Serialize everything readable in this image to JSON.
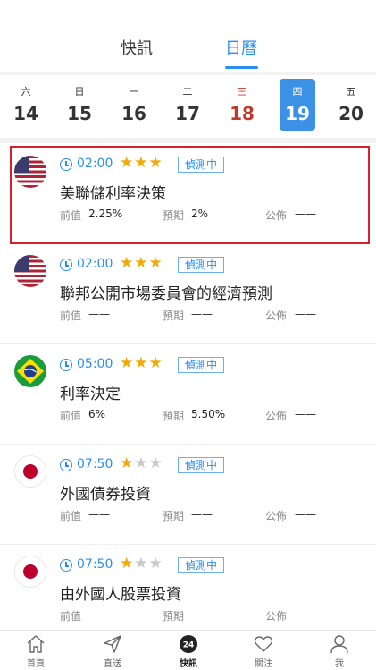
{
  "tabs": {
    "news": "快訊",
    "calendar": "日曆"
  },
  "week": [
    {
      "dow": "六",
      "num": "14"
    },
    {
      "dow": "日",
      "num": "15"
    },
    {
      "dow": "一",
      "num": "16"
    },
    {
      "dow": "二",
      "num": "17"
    },
    {
      "dow": "三",
      "num": "18"
    },
    {
      "dow": "四",
      "num": "19"
    },
    {
      "dow": "五",
      "num": "20"
    }
  ],
  "events": [
    {
      "flag": "us-flag",
      "time": "02:00",
      "stars": 3,
      "status": "偵測中",
      "title": "美聯儲利率決策",
      "prev_label": "前值",
      "prev": "2.25%",
      "forecast_label": "預期",
      "forecast": "2%",
      "actual_label": "公佈",
      "actual": "——"
    },
    {
      "flag": "us-flag",
      "time": "02:00",
      "stars": 3,
      "status": "偵測中",
      "title": "聯邦公開市場委員會的經濟預測",
      "prev_label": "前值",
      "prev": "——",
      "forecast_label": "預期",
      "forecast": "——",
      "actual_label": "公佈",
      "actual": "——"
    },
    {
      "flag": "brazil-flag",
      "time": "05:00",
      "stars": 3,
      "status": "偵測中",
      "title": "利率決定",
      "prev_label": "前值",
      "prev": "6%",
      "forecast_label": "預期",
      "forecast": "5.50%",
      "actual_label": "公佈",
      "actual": "——"
    },
    {
      "flag": "japan-flag",
      "time": "07:50",
      "stars": 1,
      "status": "偵測中",
      "title": "外國債券投資",
      "prev_label": "前值",
      "prev": "——",
      "forecast_label": "預期",
      "forecast": "——",
      "actual_label": "公佈",
      "actual": "——"
    },
    {
      "flag": "japan-flag",
      "time": "07:50",
      "stars": 1,
      "status": "偵測中",
      "title": "由外國人股票投資",
      "prev_label": "前值",
      "prev": "——",
      "forecast_label": "預期",
      "forecast": "——",
      "actual_label": "公佈",
      "actual": "——"
    }
  ],
  "bottom_nav": [
    {
      "label": "首頁",
      "icon": "home-icon"
    },
    {
      "label": "直送",
      "icon": "send-icon"
    },
    {
      "label": "快訊",
      "icon": "news-24-icon"
    },
    {
      "label": "關注",
      "icon": "heart-icon"
    },
    {
      "label": "我",
      "icon": "user-icon"
    }
  ],
  "colors": {
    "accent": "#2a8ff1",
    "selected_day": "#3a91e6",
    "highlight_border": "#d6202b",
    "star": "#f2a90a"
  }
}
